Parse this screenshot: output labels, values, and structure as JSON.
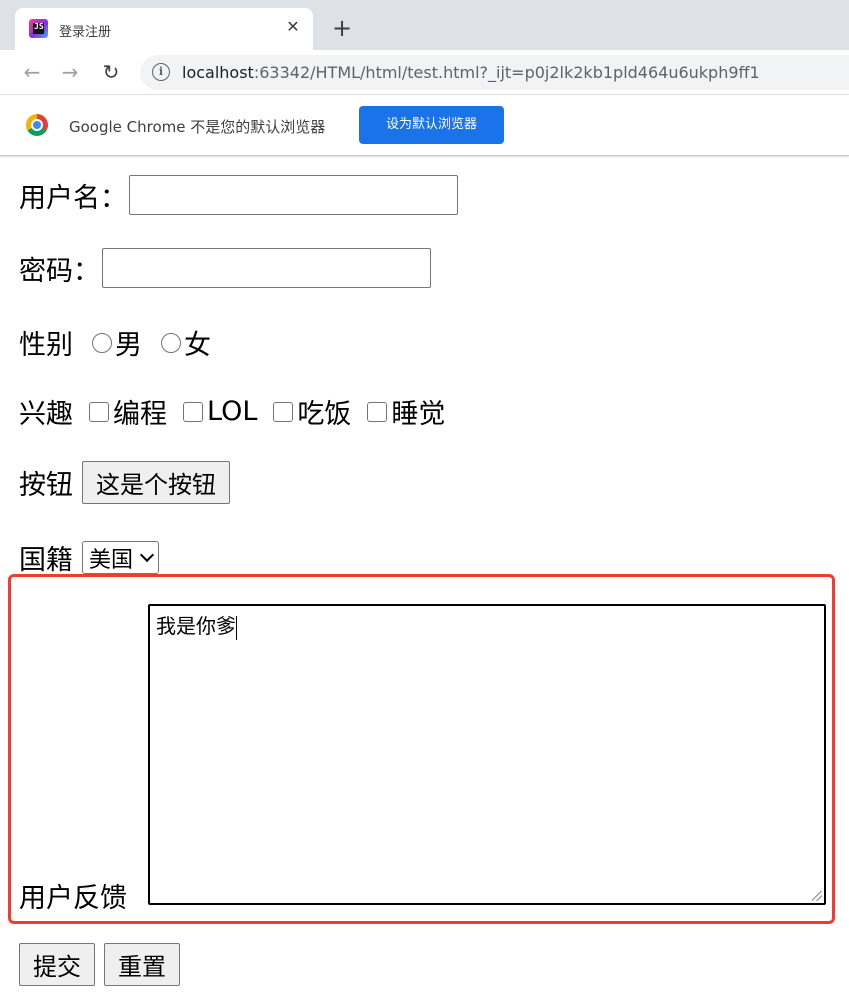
{
  "browser": {
    "tab": {
      "title": "登录注册",
      "favicon": "jetbrains-icon",
      "close": "✕"
    },
    "new_tab": "+",
    "toolbar": {
      "back": "←",
      "forward": "→",
      "reload": "↻",
      "info": "i",
      "url_host": "localhost",
      "url_rest": ":63342/HTML/html/test.html?_ijt=p0j2lk2kb1pld464u6ukph9ff1"
    },
    "infobar": {
      "message": "Google Chrome 不是您的默认浏览器",
      "button": "设为默认浏览器"
    }
  },
  "form": {
    "username": {
      "label": "用户名：",
      "value": ""
    },
    "password": {
      "label": "密码：",
      "value": ""
    },
    "gender": {
      "label": "性别",
      "options": [
        "男",
        "女"
      ]
    },
    "interests": {
      "label": "兴趣",
      "options": [
        "编程",
        "LOL",
        "吃饭",
        "睡觉"
      ]
    },
    "button_row": {
      "label": "按钮",
      "button": "这是个按钮"
    },
    "nationality": {
      "label": "国籍",
      "selected": "美国"
    },
    "feedback": {
      "label": "用户反馈",
      "value": "我是你爹"
    },
    "submit": "提交",
    "reset": "重置"
  },
  "colors": {
    "highlight_border": "#f03c30",
    "infobar_button": "#1a73e8",
    "tabstrip": "#dee1e6"
  }
}
